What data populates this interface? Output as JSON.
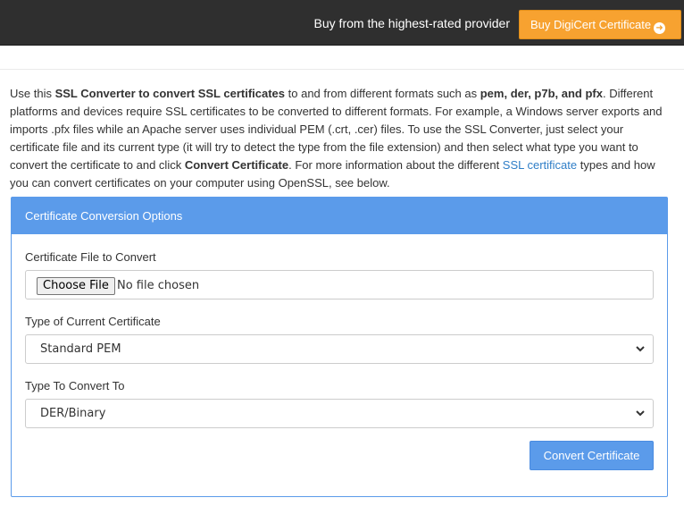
{
  "topbar": {
    "promo_text": "Buy from the highest-rated provider",
    "buy_button_label": "Buy DigiCert Certificate",
    "arrow_glyph": "➜"
  },
  "intro": {
    "p1": "Use this ",
    "b1": "SSL Converter to convert SSL certificates",
    "p2": " to and from different formats such as ",
    "b2": "pem, der, p7b, and pfx",
    "p3": ". Different platforms and devices require SSL certificates to be converted to different formats. For example, a Windows server exports and imports .pfx files while an Apache server uses individual PEM (.crt, .cer) files. To use the SSL Converter, just select your certificate file and its current type (it will try to detect the type from the file extension) and then select what type you want to convert the certificate to and click ",
    "b3": "Convert Certificate",
    "p4": ". For more information about the different ",
    "link": "SSL certificate",
    "p5": " types and how you can convert certificates on your computer using OpenSSL, see below."
  },
  "panel": {
    "heading": "Certificate Conversion Options",
    "file_label": "Certificate File to Convert",
    "choose_file_label": "Choose File",
    "file_status": "No file chosen",
    "current_type_label": "Type of Current Certificate",
    "current_type_value": "Standard PEM",
    "convert_to_label": "Type To Convert To",
    "convert_to_value": "DER/Binary",
    "convert_button_label": "Convert Certificate"
  },
  "colors": {
    "topbar_bg": "#2f2f2f",
    "accent_orange": "#f7a230",
    "accent_blue": "#5b9bea",
    "link_blue": "#2f7ec7"
  }
}
